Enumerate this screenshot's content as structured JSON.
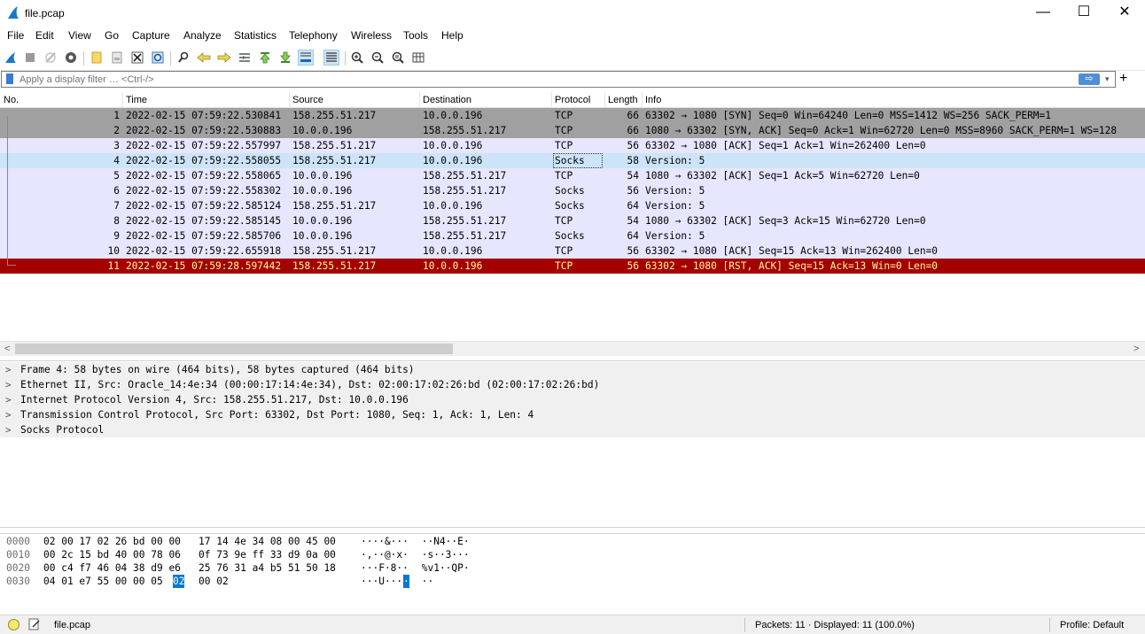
{
  "window": {
    "title": "file.pcap",
    "minimize": "—",
    "maximize": "☐",
    "close": "✕"
  },
  "menu": [
    "File",
    "Edit",
    "View",
    "Go",
    "Capture",
    "Analyze",
    "Statistics",
    "Telephony",
    "Wireless",
    "Tools",
    "Help"
  ],
  "toolbar_icons": [
    "start-capture-icon",
    "stop-capture-icon",
    "restart-capture-icon",
    "capture-options-icon",
    "open-file-icon",
    "save-file-icon",
    "close-file-icon",
    "reload-file-icon",
    "find-packet-icon",
    "go-back-icon",
    "go-forward-icon",
    "go-to-packet-icon",
    "go-first-icon",
    "go-last-icon",
    "autoscroll-icon",
    "colorize-icon",
    "zoom-in-icon",
    "zoom-out-icon",
    "zoom-normal-icon",
    "resize-columns-icon"
  ],
  "filter": {
    "placeholder": "Apply a display filter … <Ctrl-/>",
    "apply": "⇨",
    "dropdown": "▾",
    "add": "+"
  },
  "columns": [
    "No.",
    "Time",
    "Source",
    "Destination",
    "Protocol",
    "Length",
    "Info"
  ],
  "packets": [
    {
      "no": "1",
      "time": "2022-02-15 07:59:22.530841",
      "src": "158.255.51.217",
      "dst": "10.0.0.196",
      "proto": "TCP",
      "len": "66",
      "info": "63302 → 1080 [SYN] Seq=0 Win=64240 Len=0 MSS=1412 WS=256 SACK_PERM=1",
      "style": "gray"
    },
    {
      "no": "2",
      "time": "2022-02-15 07:59:22.530883",
      "src": "10.0.0.196",
      "dst": "158.255.51.217",
      "proto": "TCP",
      "len": "66",
      "info": "1080 → 63302 [SYN, ACK] Seq=0 Ack=1 Win=62720 Len=0 MSS=8960 SACK_PERM=1 WS=128",
      "style": "gray"
    },
    {
      "no": "3",
      "time": "2022-02-15 07:59:22.557997",
      "src": "158.255.51.217",
      "dst": "10.0.0.196",
      "proto": "TCP",
      "len": "56",
      "info": "63302 → 1080 [ACK] Seq=1 Ack=1 Win=262400 Len=0",
      "style": "lav"
    },
    {
      "no": "4",
      "time": "2022-02-15 07:59:22.558055",
      "src": "158.255.51.217",
      "dst": "10.0.0.196",
      "proto": "Socks",
      "len": "58",
      "info": "Version: 5",
      "style": "sel"
    },
    {
      "no": "5",
      "time": "2022-02-15 07:59:22.558065",
      "src": "10.0.0.196",
      "dst": "158.255.51.217",
      "proto": "TCP",
      "len": "54",
      "info": "1080 → 63302 [ACK] Seq=1 Ack=5 Win=62720 Len=0",
      "style": "lav"
    },
    {
      "no": "6",
      "time": "2022-02-15 07:59:22.558302",
      "src": "10.0.0.196",
      "dst": "158.255.51.217",
      "proto": "Socks",
      "len": "56",
      "info": "Version: 5",
      "style": "lav"
    },
    {
      "no": "7",
      "time": "2022-02-15 07:59:22.585124",
      "src": "158.255.51.217",
      "dst": "10.0.0.196",
      "proto": "Socks",
      "len": "64",
      "info": "Version: 5",
      "style": "lav"
    },
    {
      "no": "8",
      "time": "2022-02-15 07:59:22.585145",
      "src": "10.0.0.196",
      "dst": "158.255.51.217",
      "proto": "TCP",
      "len": "54",
      "info": "1080 → 63302 [ACK] Seq=3 Ack=15 Win=62720 Len=0",
      "style": "lav"
    },
    {
      "no": "9",
      "time": "2022-02-15 07:59:22.585706",
      "src": "10.0.0.196",
      "dst": "158.255.51.217",
      "proto": "Socks",
      "len": "64",
      "info": "Version: 5",
      "style": "lav"
    },
    {
      "no": "10",
      "time": "2022-02-15 07:59:22.655918",
      "src": "158.255.51.217",
      "dst": "10.0.0.196",
      "proto": "TCP",
      "len": "56",
      "info": "63302 → 1080 [ACK] Seq=15 Ack=13 Win=262400 Len=0",
      "style": "lav"
    },
    {
      "no": "11",
      "time": "2022-02-15 07:59:28.597442",
      "src": "158.255.51.217",
      "dst": "10.0.0.196",
      "proto": "TCP",
      "len": "56",
      "info": "63302 → 1080 [RST, ACK] Seq=15 Ack=13 Win=0 Len=0",
      "style": "red"
    }
  ],
  "details": [
    "Frame 4: 58 bytes on wire (464 bits), 58 bytes captured (464 bits)",
    "Ethernet II, Src: Oracle_14:4e:34 (00:00:17:14:4e:34), Dst: 02:00:17:02:26:bd (02:00:17:02:26:bd)",
    "Internet Protocol Version 4, Src: 158.255.51.217, Dst: 10.0.0.196",
    "Transmission Control Protocol, Src Port: 63302, Dst Port: 1080, Seq: 1, Ack: 1, Len: 4",
    "Socks Protocol"
  ],
  "details_chevron": ">",
  "hexdump": [
    {
      "offset": "0000",
      "bytes1": "02 00 17 02 26 bd 00 00",
      "bytes2": "17 14 4e 34 08 00 45 00",
      "ascii1": "····&···",
      "ascii2": " ··N4··E·"
    },
    {
      "offset": "0010",
      "bytes1": "00 2c 15 bd 40 00 78 06",
      "bytes2": "0f 73 9e ff 33 d9 0a 00",
      "ascii1": "·,··@·x·",
      "ascii2": " ·s··3···"
    },
    {
      "offset": "0020",
      "bytes1": "00 c4 f7 46 04 38 d9 e6",
      "bytes2": "25 76 31 a4 b5 51 50 18",
      "ascii1": "···F·8··",
      "ascii2": " %v1··QP·"
    },
    {
      "offset": "0030",
      "bytes1_pre": "04 01 e7 55 00 00 05 ",
      "bytes1_hl": "02",
      "bytes2": "00 02",
      "ascii1_pre": "···U···",
      "ascii1_hl": "·",
      "ascii2": " ··"
    }
  ],
  "status": {
    "file": "file.pcap",
    "packets": "Packets: 11 · Displayed: 11 (100.0%)",
    "profile": "Profile: Default"
  }
}
